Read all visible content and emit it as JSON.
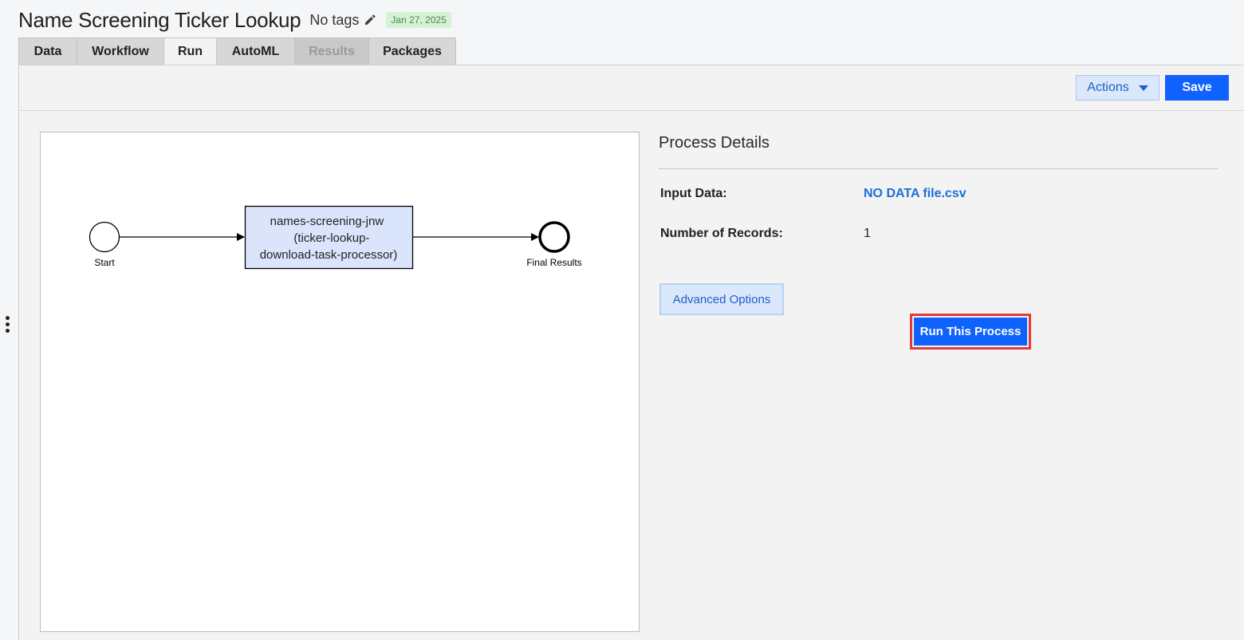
{
  "header": {
    "title": "Name Screening Ticker Lookup",
    "tags": "No tags",
    "date": "Jan 27, 2025"
  },
  "tabs": [
    {
      "label": "Data",
      "state": "normal"
    },
    {
      "label": "Workflow",
      "state": "normal"
    },
    {
      "label": "Run",
      "state": "active"
    },
    {
      "label": "AutoML",
      "state": "normal"
    },
    {
      "label": "Results",
      "state": "disabled"
    },
    {
      "label": "Packages",
      "state": "normal"
    }
  ],
  "toolbar": {
    "actions_label": "Actions",
    "save_label": "Save"
  },
  "diagram": {
    "start_label": "Start",
    "task_lines": [
      "names-screening-jnw",
      "(ticker-lookup-",
      "download-task-processor)"
    ],
    "end_label": "Final Results"
  },
  "details": {
    "title": "Process Details",
    "input_label": "Input Data:",
    "input_value": "NO DATA file.csv",
    "records_label": "Number of Records:",
    "records_value": "1",
    "advanced_label": "Advanced Options",
    "run_label": "Run This Process"
  },
  "colors": {
    "primary": "#0f62fe",
    "link": "#1a6fd9",
    "highlight": "#e23b3b",
    "task_fill": "#dae5fc"
  }
}
